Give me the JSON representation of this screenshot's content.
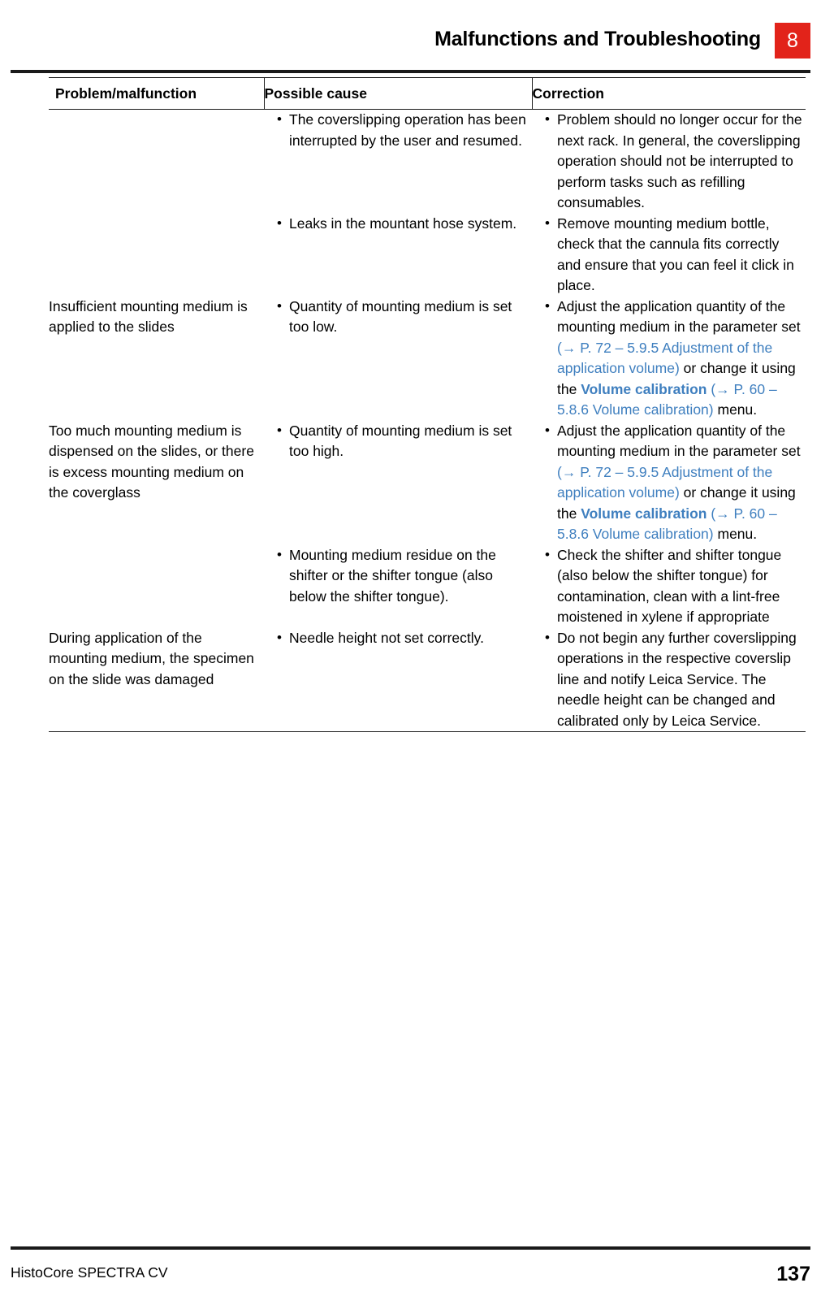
{
  "header": {
    "title": "Malfunctions and Troubleshooting",
    "chapter": "8"
  },
  "table": {
    "headers": {
      "problem": "Problem/malfunction",
      "cause": "Possible cause",
      "correction": "Correction"
    },
    "rows": [
      {
        "problem": "",
        "cause": "The coverslipping operation has been interrupted by the user and resumed.",
        "correction": "Problem should no longer occur for the next rack. In general, the coverslipping operation should not be interrupted to perform tasks such as refilling consumables."
      },
      {
        "problem": "",
        "cause": "Leaks in the mountant hose system.",
        "correction": "Remove mounting medium bottle, check that the cannula fits correctly and ensure that you can feel it click in place."
      },
      {
        "problem": "Insufficient mounting medium is applied to the slides",
        "cause": "Quantity of mounting medium is set too low.",
        "correction_parts": [
          {
            "text": "Adjust the application quantity of the mounting medium in the parameter set ",
            "style": "normal"
          },
          {
            "text": "(→ P. 72 – 5.9.5 Adjustment of the application volume)",
            "style": "ref"
          },
          {
            "text": " or change it using the ",
            "style": "normal"
          },
          {
            "text": "Volume calibration",
            "style": "bold-ref"
          },
          {
            "text": " ",
            "style": "normal"
          },
          {
            "text": "(→ P. 60 – 5.8.6 Volume calibration)",
            "style": "ref"
          },
          {
            "text": " menu.",
            "style": "normal"
          }
        ]
      },
      {
        "problem": "Too much mounting medium is dispensed on the slides, or there is excess mounting medium on the coverglass",
        "cause": "Quantity of mounting medium is set too high.",
        "correction_parts": [
          {
            "text": "Adjust the application quantity of the mounting medium in the parameter set ",
            "style": "normal"
          },
          {
            "text": "(→ P. 72 – 5.9.5 Adjustment of the application volume)",
            "style": "ref"
          },
          {
            "text": " or change it using the ",
            "style": "normal"
          },
          {
            "text": "Volume calibration",
            "style": "bold-ref"
          },
          {
            "text": " ",
            "style": "normal"
          },
          {
            "text": "(→ P. 60 – 5.8.6 Volume calibration)",
            "style": "ref"
          },
          {
            "text": " menu.",
            "style": "normal"
          }
        ]
      },
      {
        "problem": "",
        "cause": "Mounting medium residue on the shifter or the shifter tongue (also below the shifter tongue).",
        "correction": "Check the shifter and shifter tongue (also below the shifter tongue) for contamination, clean with a lint-free moistened in xylene if appropriate"
      },
      {
        "problem": "During application of the mounting medium, the specimen on the slide was damaged",
        "cause": "Needle height not set correctly.",
        "correction": "Do not begin any further coverslipping operations in the respective coverslip line and notify Leica Service. The needle height can be changed and calibrated only by Leica Service."
      }
    ]
  },
  "footer": {
    "document": "HistoCore SPECTRA CV",
    "page": "137"
  },
  "colors": {
    "accent": "#e2231a",
    "reference_link": "#3f7fbf",
    "rule": "#1a1a1a"
  }
}
